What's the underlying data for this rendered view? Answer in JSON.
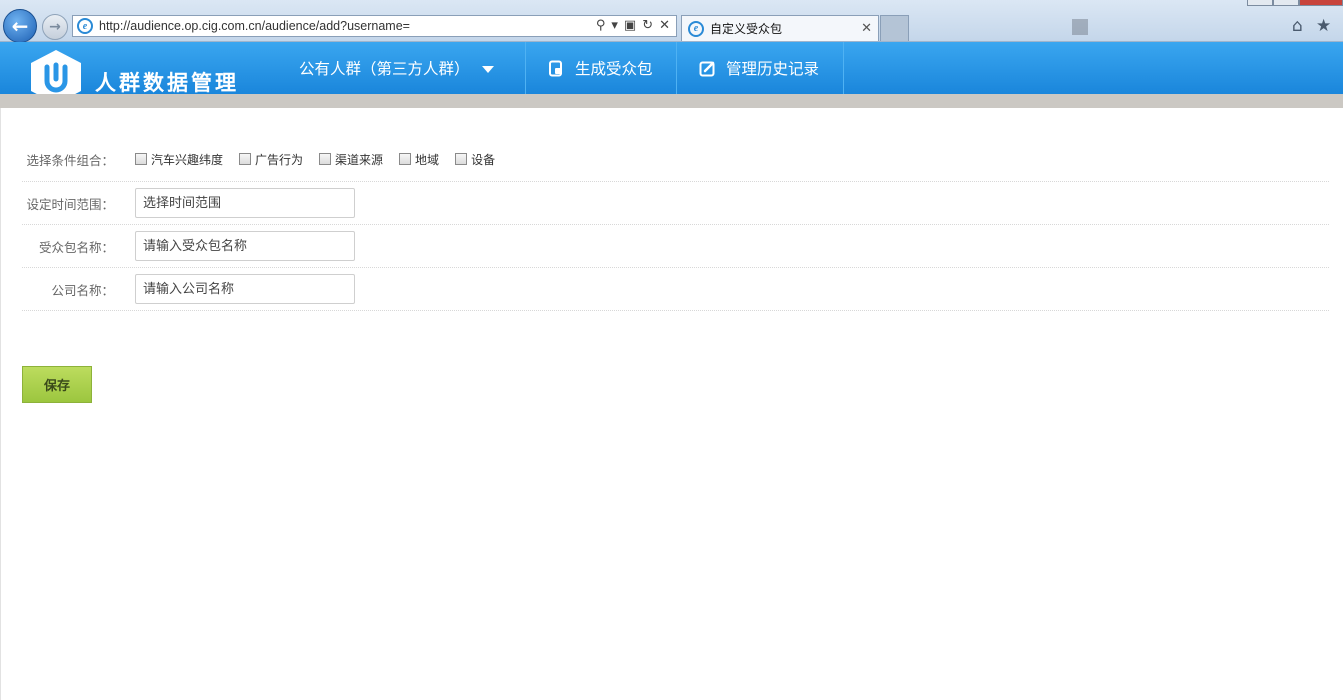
{
  "browser": {
    "url": "http://audience.op.cig.com.cn/audience/add?username=",
    "tab_title": "自定义受众包",
    "ie_icon": "e",
    "icons": [
      "back-arrow-icon",
      "forward-arrow-icon",
      "search-icon",
      "dropdown-icon",
      "compat-view-icon",
      "refresh-icon",
      "stop-icon",
      "close-tab-icon",
      "home-icon",
      "favorites-star-icon"
    ]
  },
  "app": {
    "brand": "人群数据管理",
    "menu": {
      "public_label": "公有人群（第三方人群）",
      "generate_label": "生成受众包",
      "history_label": "管理历史记录"
    },
    "accent": "#1a86db"
  },
  "form": {
    "conditions": {
      "label": "选择条件组合：",
      "options": [
        "汽车兴趣纬度",
        "广告行为",
        "渠道来源",
        "地域",
        "设备"
      ]
    },
    "time": {
      "label": "设定时间范围：",
      "placeholder": "选择时间范围"
    },
    "package": {
      "label": "受众包名称：",
      "placeholder": "请输入受众包名称"
    },
    "company": {
      "label": "公司名称：",
      "placeholder": "请输入公司名称"
    },
    "save_label": "保存",
    "save_color": "#9cc63f"
  }
}
